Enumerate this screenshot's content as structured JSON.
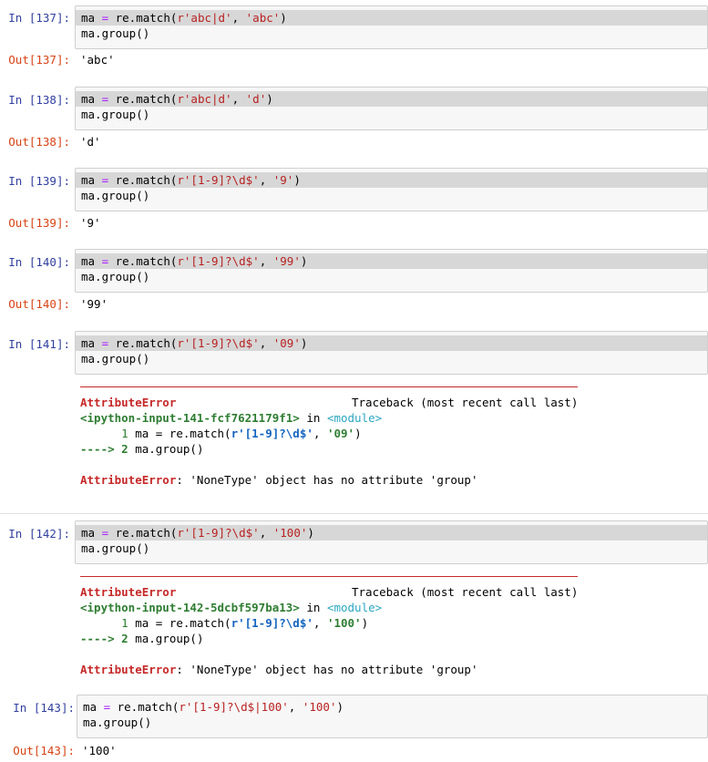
{
  "cells": [
    {
      "in": "In  [137]:",
      "line1": [
        "ma ",
        "=",
        " re.match(",
        "r'abc|d'",
        ", ",
        "'abc'",
        ")"
      ],
      "line2": "ma.group()",
      "out": "Out[137]:",
      "result": "'abc'"
    },
    {
      "in": "In  [138]:",
      "line1": [
        "ma ",
        "=",
        " re.match(",
        "r'abc|d'",
        ", ",
        "'d'",
        ")"
      ],
      "line2": "ma.group()",
      "out": "Out[138]:",
      "result": "'d'"
    },
    {
      "in": "In  [139]:",
      "line1": [
        "ma ",
        "=",
        " re.match(",
        "r'[1-9]?\\d$'",
        ", ",
        "'9'",
        ")"
      ],
      "line2": "ma.group()",
      "out": "Out[139]:",
      "result": "'9'"
    },
    {
      "in": "In  [140]:",
      "line1": [
        "ma ",
        "=",
        " re.match(",
        "r'[1-9]?\\d$'",
        ", ",
        "'99'",
        ")"
      ],
      "line2": "ma.group()",
      "out": "Out[140]:",
      "result": "'99'"
    },
    {
      "in": "In  [141]:",
      "line1": [
        "ma ",
        "=",
        " re.match(",
        "r'[1-9]?\\d$'",
        ", ",
        "'09'",
        ")"
      ],
      "line2": "ma.group()",
      "tb": {
        "error": "AttributeError",
        "header": "Traceback (most recent call last)",
        "input": "<ipython-input-141-fcf7621179f1>",
        "in_word": " in ",
        "module": "<module>",
        "l1_num": "      1 ",
        "l1_code": "ma = re.match(",
        "l1_str": "r'[1-9]?\\d$'",
        "l1_comma": ", ",
        "l1_arg": "'09'",
        "l1_close": ")",
        "l2_arrow": "----> 2 ",
        "l2_code": "ma.group()",
        "msg": ": 'NoneType' object has no attribute 'group'"
      }
    },
    {
      "in": "In  [142]:",
      "line1": [
        "ma ",
        "=",
        " re.match(",
        "r'[1-9]?\\d$'",
        ", ",
        "'100'",
        ")"
      ],
      "line2": "ma.group()",
      "tb": {
        "error": "AttributeError",
        "header": "Traceback (most recent call last)",
        "input": "<ipython-input-142-5dcbf597ba13>",
        "in_word": " in ",
        "module": "<module>",
        "l1_num": "      1 ",
        "l1_code": "ma = re.match(",
        "l1_str": "r'[1-9]?\\d$'",
        "l1_comma": ", ",
        "l1_arg": "'100'",
        "l1_close": ")",
        "l2_arrow": "----> 2 ",
        "l2_code": "ma.group()",
        "msg": ": 'NoneType' object has no attribute 'group'"
      }
    },
    {
      "in": "In  [143]:",
      "line1": [
        "ma ",
        "=",
        " re.match(",
        "r'[1-9]?\\d$|100'",
        ", ",
        "'100'",
        ")"
      ],
      "line2": "ma.group()",
      "out": "Out[143]:",
      "result": "'100'"
    }
  ]
}
